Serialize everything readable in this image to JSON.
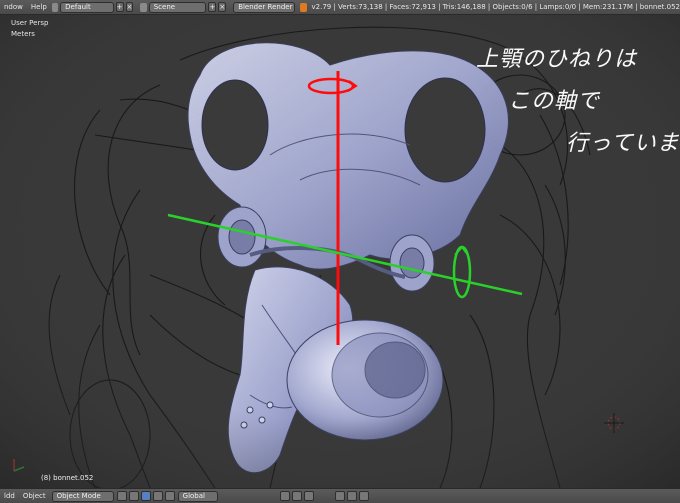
{
  "header": {
    "menu_window": "ndow",
    "menu_help": "Help",
    "layout_value": "Default",
    "scene_value": "Scene",
    "engine_value": "Blender Render",
    "stats": "v2.79 | Verts:73,138 | Faces:72,913 | Tris:146,188 | Objects:0/6 | Lamps:0/0 | Mem:231.17M | bonnet.052"
  },
  "viewport": {
    "view_name": "User Persp",
    "units": "Meters",
    "object_label": "(8) bonnet.052",
    "annotation_lines": [
      "上顎のひねりは",
      "この軸で",
      "行っています。"
    ]
  },
  "footer": {
    "menu_view": "ldd",
    "menu_object": "Object",
    "mode_value": "Object Mode",
    "orientation_value": "Global"
  },
  "colors": {
    "red_axis": "#ff0b0b",
    "green_axis": "#2bd12b",
    "mesh": "#b9bfe6",
    "header_bg": "#4e4e4e"
  }
}
